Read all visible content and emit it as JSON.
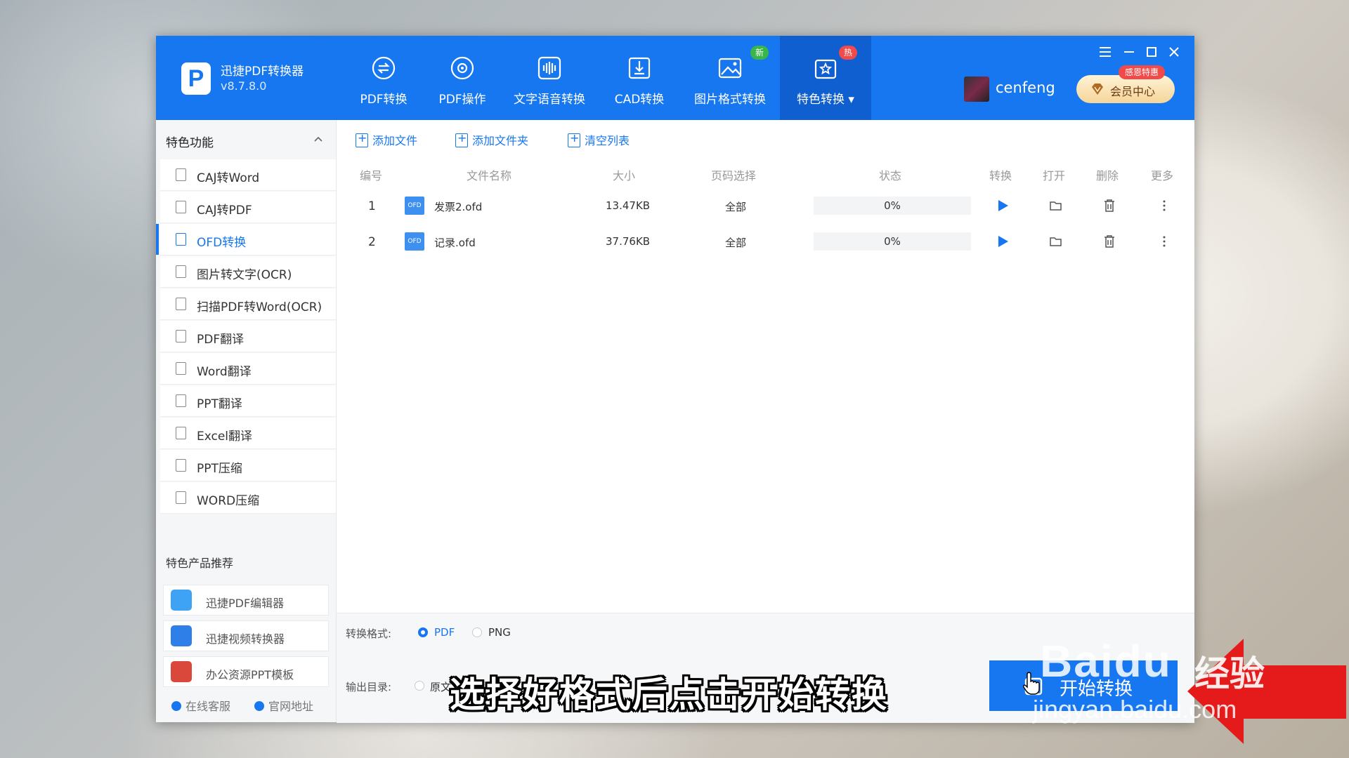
{
  "app": {
    "name": "迅捷PDF转换器",
    "version": "v8.7.8.0",
    "logo_letter": "P"
  },
  "nav": [
    {
      "label": "PDF转换",
      "icon": "pdf-convert-icon"
    },
    {
      "label": "PDF操作",
      "icon": "pdf-operate-icon"
    },
    {
      "label": "文字语音转换",
      "icon": "audio-wave-icon"
    },
    {
      "label": "CAD转换",
      "icon": "cad-icon"
    },
    {
      "label": "图片格式转换",
      "icon": "image-icon",
      "badge": "新"
    },
    {
      "label": "特色转换",
      "icon": "feature-icon",
      "badge": "热",
      "active": true
    }
  ],
  "user": {
    "name": "cenfeng",
    "vip_label": "会员中心",
    "vip_badge": "感恩特惠"
  },
  "sidebar": {
    "title": "特色功能",
    "items": [
      {
        "label": "CAJ转Word"
      },
      {
        "label": "CAJ转PDF"
      },
      {
        "label": "OFD转换",
        "active": true
      },
      {
        "label": "图片转文字(OCR)"
      },
      {
        "label": "扫描PDF转Word(OCR)"
      },
      {
        "label": "PDF翻译"
      },
      {
        "label": "Word翻译"
      },
      {
        "label": "PPT翻译"
      },
      {
        "label": "Excel翻译"
      },
      {
        "label": "PPT压缩"
      },
      {
        "label": "WORD压缩"
      }
    ],
    "recommend_title": "特色产品推荐",
    "recommend": [
      {
        "label": "迅捷PDF编辑器",
        "color": "#3fa3f5"
      },
      {
        "label": "迅捷视频转换器",
        "color": "#2f7fe8"
      },
      {
        "label": "办公资源PPT模板",
        "color": "#d9483b"
      }
    ],
    "footer": {
      "service": "在线客服",
      "site": "官网地址"
    }
  },
  "toolbar": {
    "add_file": "添加文件",
    "add_folder": "添加文件夹",
    "clear_list": "清空列表"
  },
  "table": {
    "headers": [
      "编号",
      "文件名称",
      "大小",
      "页码选择",
      "状态",
      "转换",
      "打开",
      "删除",
      "更多"
    ],
    "rows": [
      {
        "index": "1",
        "name": "发票2.ofd",
        "size": "13.47KB",
        "pages": "全部",
        "progress": 0,
        "status": "0%"
      },
      {
        "index": "2",
        "name": "记录.ofd",
        "size": "37.76KB",
        "pages": "全部",
        "progress": 0,
        "status": "0%"
      }
    ],
    "file_icon_text": "OFD"
  },
  "bottom": {
    "format_label": "转换格式:",
    "formats": [
      {
        "label": "PDF",
        "selected": true
      },
      {
        "label": "PNG",
        "selected": false
      }
    ],
    "output_label": "输出目录:",
    "output_option": "原文",
    "start_label": "开始转换"
  },
  "overlay": {
    "subtitle": "选择好格式后点击开始转换",
    "watermark_brand": "Baidu",
    "watermark_jy": "经验",
    "watermark_url": "jingyan.baidu.com"
  },
  "colors": {
    "primary": "#1677f0",
    "badge_new": "#39b54a",
    "badge_hot": "#f04a4a"
  }
}
